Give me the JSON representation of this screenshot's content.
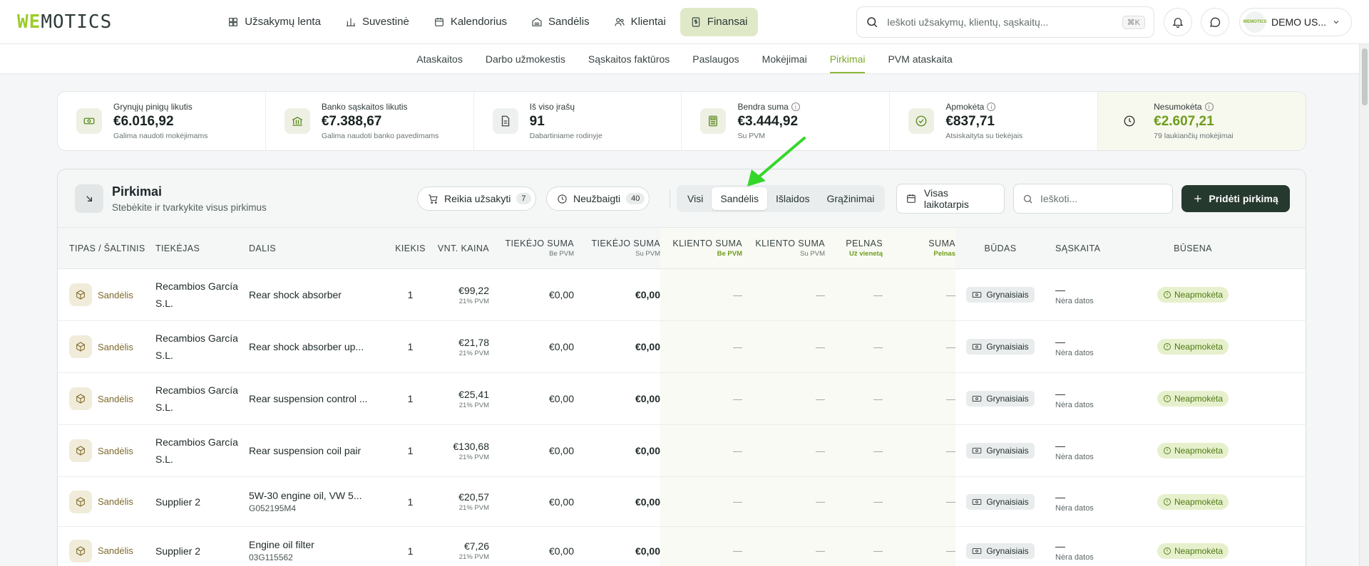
{
  "brand": {
    "logo_part1": "WE",
    "logo_part2": "MOTICS"
  },
  "nav": [
    {
      "label": "Užsakymų lenta",
      "icon": "grid-icon"
    },
    {
      "label": "Suvestinė",
      "icon": "bar-chart-icon"
    },
    {
      "label": "Kalendorius",
      "icon": "calendar-icon"
    },
    {
      "label": "Sandėlis",
      "icon": "warehouse-icon"
    },
    {
      "label": "Klientai",
      "icon": "users-icon"
    },
    {
      "label": "Finansai",
      "icon": "finance-icon",
      "active": true
    }
  ],
  "search": {
    "placeholder": "Ieškoti užsakymų, klientų, sąskaitų...",
    "shortcut": "⌘K"
  },
  "user": {
    "name": "DEMO US...",
    "avatar_text": "WEMOTICS"
  },
  "subnav": [
    "Ataskaitos",
    "Darbo užmokestis",
    "Sąskaitos faktūros",
    "Paslaugos",
    "Mokėjimai",
    "Pirkimai",
    "PVM ataskaita"
  ],
  "subnav_active": "Pirkimai",
  "stats": [
    {
      "label": "Grynųjų pinigų likutis",
      "value": "€6.016,92",
      "sub": "Galima naudoti mokėjimams",
      "icon": "cash-icon"
    },
    {
      "label": "Banko sąskaitos likutis",
      "value": "€7.388,67",
      "sub": "Galima naudoti banko pavedimams",
      "icon": "bank-icon"
    },
    {
      "label": "Iš viso įrašų",
      "value": "91",
      "sub": "Dabartiniame rodinyje",
      "icon": "document-icon"
    },
    {
      "label": "Bendra suma",
      "value": "€3.444,92",
      "sub": "Su PVM",
      "icon": "calculator-icon",
      "info": true
    },
    {
      "label": "Apmokėta",
      "value": "€837,71",
      "sub": "Atsiskaityta su tiekėjais",
      "icon": "check-circle-icon",
      "info": true
    },
    {
      "label": "Nesumokėta",
      "value": "€2.607,21",
      "sub": "79 laukiančių mokėjimai",
      "icon": "clock-icon",
      "info": true
    }
  ],
  "panel": {
    "title": "Pirkimai",
    "subtitle": "Stebėkite ir tvarkykite visus pirkimus",
    "filter_needs_order": {
      "label": "Reikia užsakyti",
      "count": "7"
    },
    "filter_unfinished": {
      "label": "Neužbaigti",
      "count": "40"
    },
    "segments": [
      "Visi",
      "Sandėlis",
      "Išlaidos",
      "Grąžinimai"
    ],
    "segment_active": "Sandėlis",
    "date_range": "Visas laikotarpis",
    "search_placeholder": "Ieškoti...",
    "add_button": "Pridėti pirkimą"
  },
  "columns": [
    {
      "label": "Tipas / Šaltinis"
    },
    {
      "label": "Tiekėjas"
    },
    {
      "label": "Dalis"
    },
    {
      "label": "Kiekis"
    },
    {
      "label": "Vnt. kaina"
    },
    {
      "label": "Tiekėjo suma",
      "sub": "Be PVM"
    },
    {
      "label": "Tiekėjo suma",
      "sub": "Su PVM"
    },
    {
      "label": "Kliento suma",
      "sub": "Be PVM"
    },
    {
      "label": "Kliento suma",
      "sub": "Su PVM"
    },
    {
      "label": "Pelnas",
      "sub": "Už vienetą"
    },
    {
      "label": "Suma",
      "sub": "Pelnas"
    },
    {
      "label": "Būdas"
    },
    {
      "label": "Sąskaita"
    },
    {
      "label": "Būsena"
    }
  ],
  "rows": [
    {
      "source": "Sandėlis",
      "supplier": "Recambios García S.L.",
      "part": "Rear shock absorber",
      "part_code": "",
      "qty": "1",
      "unit_price": "€99,22",
      "vat": "21% PVM",
      "supplier_ex": "€0,00",
      "supplier_inc": "€0,00",
      "client_ex": "—",
      "client_inc": "—",
      "profit_unit": "—",
      "profit_total": "—",
      "method": "Grynaisiais",
      "invoice": "—",
      "invoice_note": "Nėra datos",
      "status": "Neapmokėta"
    },
    {
      "source": "Sandėlis",
      "supplier": "Recambios García S.L.",
      "part": "Rear shock absorber up...",
      "part_code": "",
      "qty": "1",
      "unit_price": "€21,78",
      "vat": "21% PVM",
      "supplier_ex": "€0,00",
      "supplier_inc": "€0,00",
      "client_ex": "—",
      "client_inc": "—",
      "profit_unit": "—",
      "profit_total": "—",
      "method": "Grynaisiais",
      "invoice": "—",
      "invoice_note": "Nėra datos",
      "status": "Neapmokėta"
    },
    {
      "source": "Sandėlis",
      "supplier": "Recambios García S.L.",
      "part": "Rear suspension control ...",
      "part_code": "",
      "qty": "1",
      "unit_price": "€25,41",
      "vat": "21% PVM",
      "supplier_ex": "€0,00",
      "supplier_inc": "€0,00",
      "client_ex": "—",
      "client_inc": "—",
      "profit_unit": "—",
      "profit_total": "—",
      "method": "Grynaisiais",
      "invoice": "—",
      "invoice_note": "Nėra datos",
      "status": "Neapmokėta"
    },
    {
      "source": "Sandėlis",
      "supplier": "Recambios García S.L.",
      "part": "Rear suspension coil pair",
      "part_code": "",
      "qty": "1",
      "unit_price": "€130,68",
      "vat": "21% PVM",
      "supplier_ex": "€0,00",
      "supplier_inc": "€0,00",
      "client_ex": "—",
      "client_inc": "—",
      "profit_unit": "—",
      "profit_total": "—",
      "method": "Grynaisiais",
      "invoice": "—",
      "invoice_note": "Nėra datos",
      "status": "Neapmokėta"
    },
    {
      "source": "Sandėlis",
      "supplier": "Supplier 2",
      "part": "5W-30 engine oil, VW 5...",
      "part_code": "G052195M4",
      "qty": "1",
      "unit_price": "€20,57",
      "vat": "21% PVM",
      "supplier_ex": "€0,00",
      "supplier_inc": "€0,00",
      "client_ex": "—",
      "client_inc": "—",
      "profit_unit": "—",
      "profit_total": "—",
      "method": "Grynaisiais",
      "invoice": "—",
      "invoice_note": "Nėra datos",
      "status": "Neapmokėta"
    },
    {
      "source": "Sandėlis",
      "supplier": "Supplier 2",
      "part": "Engine oil filter",
      "part_code": "03G115562",
      "qty": "1",
      "unit_price": "€7,26",
      "vat": "21% PVM",
      "supplier_ex": "€0,00",
      "supplier_inc": "€0,00",
      "client_ex": "—",
      "client_inc": "—",
      "profit_unit": "—",
      "profit_total": "—",
      "method": "Grynaisiais",
      "invoice": "—",
      "invoice_note": "Nėra datos",
      "status": "Neapmokėta"
    }
  ],
  "colors": {
    "accent": "#9ccc2b",
    "nav_active": "#dfe9c7",
    "primary_button": "#26392f",
    "annotation_arrow": "#35d62a"
  }
}
